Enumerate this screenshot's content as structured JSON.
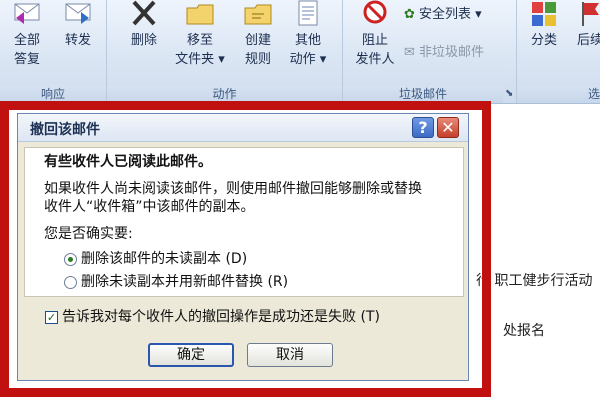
{
  "ribbon": {
    "reply_all": "全部\n答复",
    "forward": "转发",
    "delete": "删除",
    "move_to": "移至\n文件夹 ▾",
    "create_rule": "创建\n规则",
    "other_actions": "其他\n动作 ▾",
    "block_sender": "阻止\n发件人",
    "safe_lists": "安全列表 ▾",
    "not_junk": "非垃圾邮件",
    "categorize": "分类",
    "followup": "后续",
    "group_respond": "响应",
    "group_actions": "动作",
    "group_junk": "垃圾邮件",
    "group_options": "选"
  },
  "email_body": {
    "line1_right": "行  职工健步行活动",
    "line2_right": "处报名"
  },
  "dialog": {
    "title": "撤回该邮件",
    "help_glyph": "?",
    "close_glyph": "✕",
    "headline": "有些收件人已阅读此邮件。",
    "info_line1": "如果收件人尚未阅读该邮件，则使用邮件撤回能够删除或替换",
    "info_line2": "收件人“收件箱”中该邮件的副本。",
    "question": "您是否确实要:",
    "option_delete": "删除该邮件的未读副本 (D)",
    "option_replace": "删除未读副本并用新邮件替换 (R)",
    "notify_label": "告诉我对每个收件人的撤回操作是成功还是失败 (T)",
    "ok_label": "确定",
    "cancel_label": "取消",
    "selected_option": "delete",
    "notify_checked": true
  }
}
